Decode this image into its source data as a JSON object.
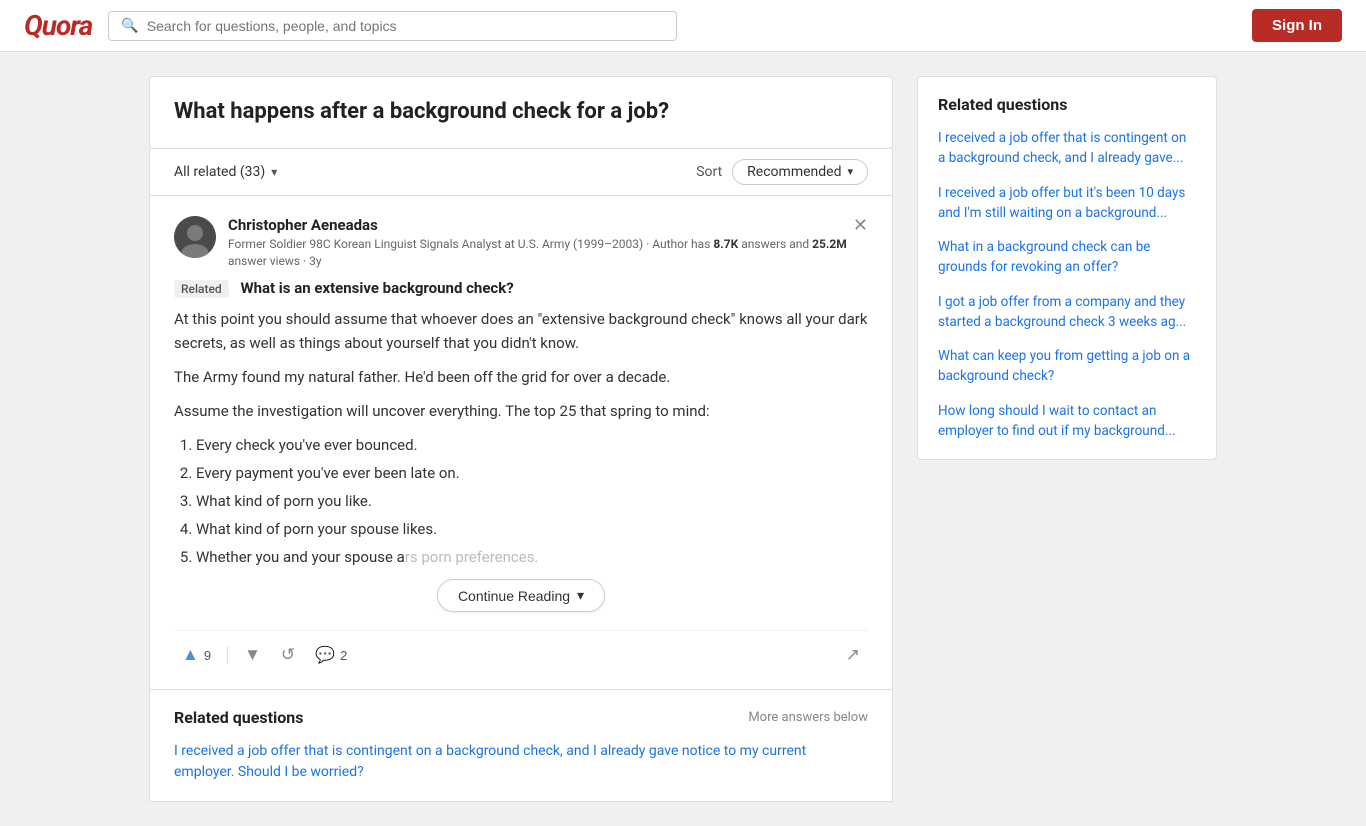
{
  "header": {
    "logo": "Quora",
    "search_placeholder": "Search for questions, people, and topics",
    "sign_in_label": "Sign In"
  },
  "question": {
    "title": "What happens after a background check for a job?",
    "all_related_label": "All related (33)",
    "sort_label": "Sort",
    "sort_value": "Recommended"
  },
  "answer": {
    "author_name": "Christopher Aeneadas",
    "author_bio_prefix": "Former Soldier 98C Korean Linguist Signals Analyst at U.S. Army (1999–2003) · Author has ",
    "author_answers": "8.7K",
    "author_bio_suffix": " answers and ",
    "author_views": "25.2M",
    "author_views_suffix": " answer views · 3y",
    "related_tag": "Related",
    "related_question": "What is an extensive background check?",
    "body_p1": "At this point you should assume that whoever does an \"extensive background check\" knows all your dark secrets, as well as things about yourself that you didn't know.",
    "body_p2": "The Army found my natural father. He'd been off the grid for over a decade.",
    "body_p3": "Assume the investigation will uncover everything. The top 25 that spring to mind:",
    "list_items": [
      "Every check you've ever bounced.",
      "Every payment you've ever been late on.",
      "What kind of porn you like.",
      "What kind of porn your spouse likes.",
      "Whether you and your spouse a"
    ],
    "list_item_5_faded": "rs porn preferences.",
    "continue_reading_label": "Continue Reading",
    "upvote_count": "9",
    "comment_count": "2",
    "actions": {
      "upvote": "▲",
      "downvote": "▼",
      "share": "↺",
      "comment": "💬",
      "forward": "⇒"
    }
  },
  "related_bottom": {
    "title": "Related questions",
    "more_label": "More answers below",
    "link": "I received a job offer that is contingent on a background check, and I already gave notice to my current employer. Should I be worried?"
  },
  "sidebar": {
    "title": "Related questions",
    "links": [
      "I received a job offer that is contingent on a background check, and I already gave...",
      "I received a job offer but it's been 10 days and I'm still waiting on a background...",
      "What in a background check can be grounds for revoking an offer?",
      "I got a job offer from a company and they started a background check 3 weeks ag...",
      "What can keep you from getting a job on a background check?",
      "How long should I wait to contact an employer to find out if my background..."
    ]
  }
}
